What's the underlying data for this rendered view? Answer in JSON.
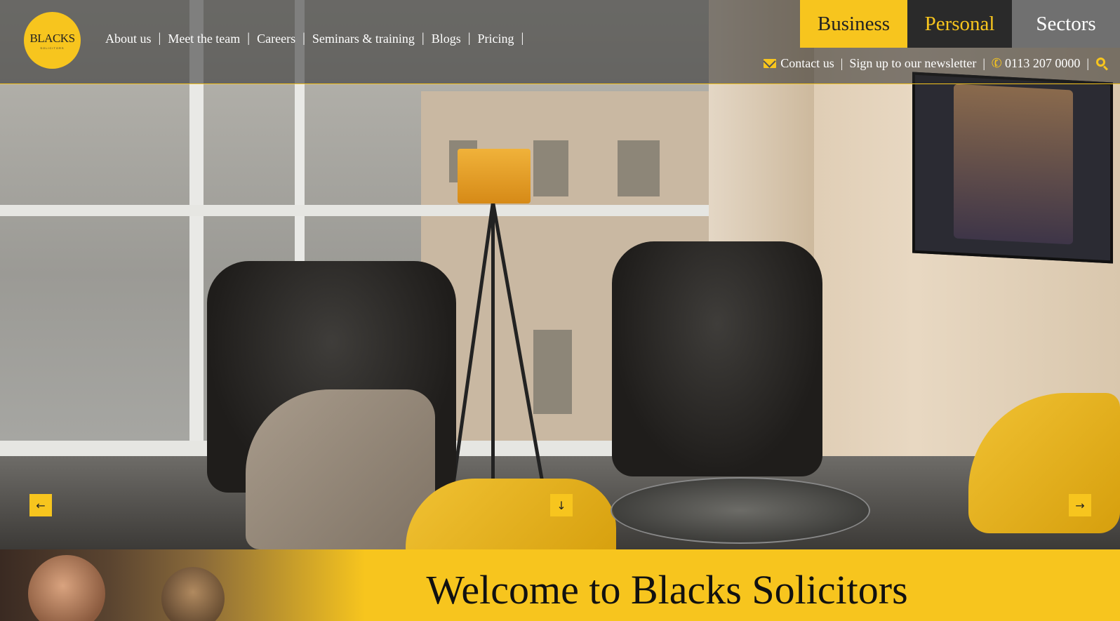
{
  "logo": {
    "word": "BLACKS",
    "sub": "SOLICITORS"
  },
  "main_nav": [
    "About us",
    "Meet the team",
    "Careers",
    "Seminars & training",
    "Blogs",
    "Pricing"
  ],
  "tabs": {
    "business": "Business",
    "personal": "Personal",
    "sectors": "Sectors"
  },
  "util_nav": {
    "contact": "Contact us",
    "newsletter": "Sign up to our newsletter",
    "phone": "0113 207 0000"
  },
  "slider": {
    "prev_icon": "arrow-left-icon",
    "down_icon": "arrow-down-icon",
    "next_icon": "arrow-right-icon"
  },
  "welcome": {
    "title": "Welcome to Blacks Solicitors"
  },
  "colors": {
    "brand_yellow": "#f7c51e",
    "dark": "#2a2a2a",
    "grey_tab": "#707070"
  }
}
